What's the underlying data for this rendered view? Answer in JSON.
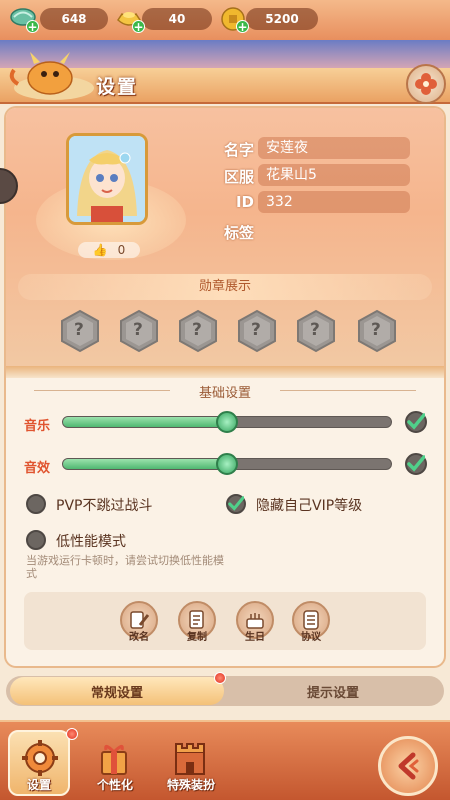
{
  "currencies": [
    {
      "icon": "jade-icon",
      "value": "648"
    },
    {
      "icon": "gold-ingot-icon",
      "value": "40"
    },
    {
      "icon": "coin-icon",
      "value": "5200"
    }
  ],
  "header": {
    "title": "设置"
  },
  "profile": {
    "name_label": "名字",
    "name": "安莲夜",
    "server_label": "区服",
    "server": "花果山5",
    "id_label": "ID",
    "id": "332",
    "tag_label": "标签",
    "likes": "0"
  },
  "medals": {
    "title": "勋章展示",
    "slots": [
      "?",
      "?",
      "?",
      "?",
      "?",
      "?"
    ]
  },
  "basic": {
    "title": "基础设置",
    "music_label": "音乐",
    "music_level": 0.5,
    "music_enabled": true,
    "sound_label": "音效",
    "sound_level": 0.5,
    "sound_enabled": true,
    "pvp_label": "PVP不跳过战斗",
    "pvp_checked": false,
    "hide_vip_label": "隐藏自己VIP等级",
    "hide_vip_checked": true,
    "low_perf_label": "低性能模式",
    "low_perf_checked": false,
    "low_perf_hint": "当游戏运行卡顿时，请尝试切换低性能模式"
  },
  "tools": [
    {
      "icon": "pen-icon",
      "label": "改名"
    },
    {
      "icon": "copy-icon",
      "label": "复制"
    },
    {
      "icon": "cake-icon",
      "label": "生日"
    },
    {
      "icon": "scroll-icon",
      "label": "协议"
    }
  ],
  "tabs": [
    {
      "label": "常规设置",
      "active": true,
      "badge": true
    },
    {
      "label": "提示设置",
      "active": false,
      "badge": false
    }
  ],
  "bottom_nav": [
    {
      "icon": "gear-icon",
      "label": "设置",
      "active": true,
      "badge": true
    },
    {
      "icon": "gift-icon",
      "label": "个性化",
      "active": false,
      "badge": false
    },
    {
      "icon": "castle-icon",
      "label": "特殊装扮",
      "active": false,
      "badge": false
    }
  ],
  "colors": {
    "accent": "#e0542f",
    "slider_fill": "#4fb871",
    "panel": "#fbf2e6",
    "badge": "#e02f1e"
  }
}
